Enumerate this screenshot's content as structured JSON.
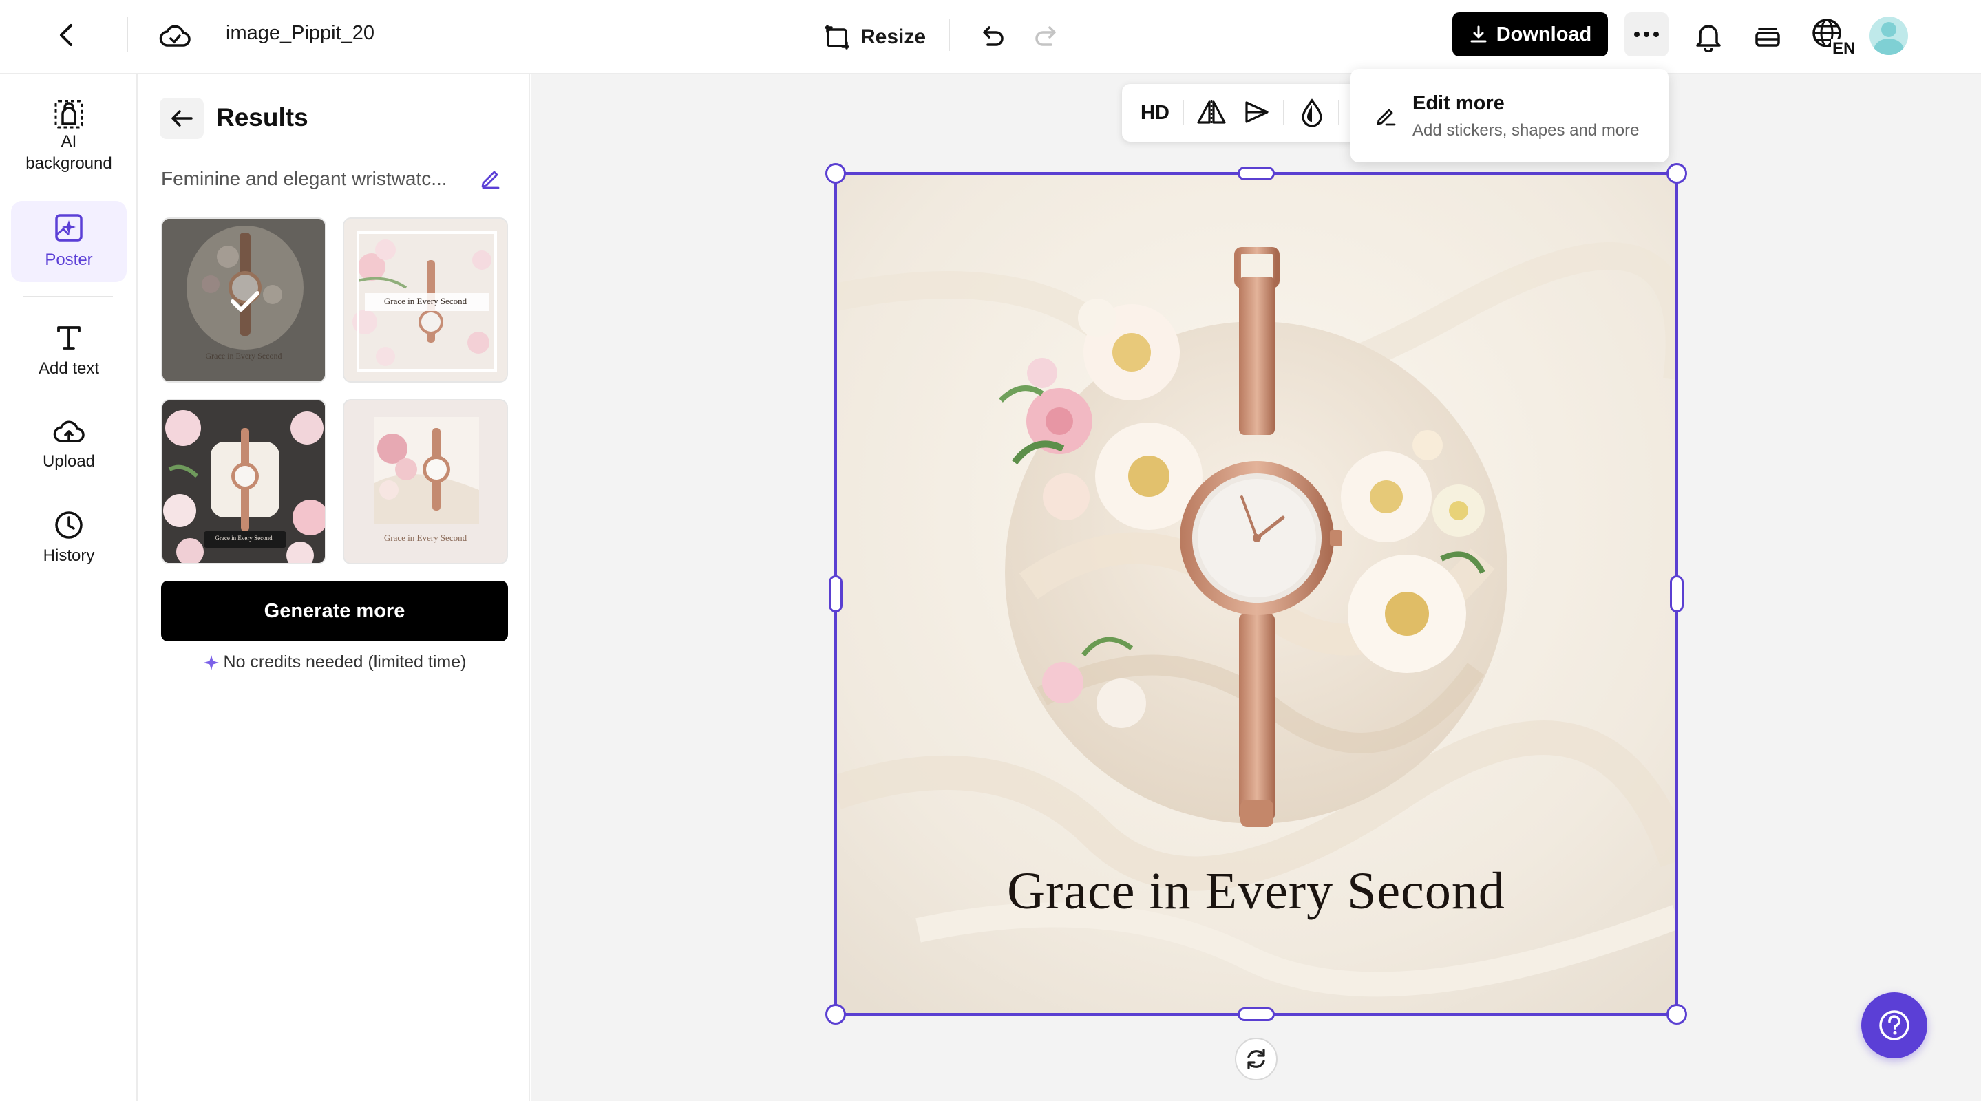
{
  "topbar": {
    "filename": "image_Pippit_20",
    "resize_label": "Resize",
    "download_label": "Download",
    "language_code": "EN"
  },
  "leftnav": {
    "items": [
      {
        "label": "AI background",
        "icon": "ai-background-icon"
      },
      {
        "label": "Poster",
        "icon": "poster-icon",
        "active": true
      },
      {
        "label": "Add text",
        "icon": "text-icon"
      },
      {
        "label": "Upload",
        "icon": "upload-icon"
      },
      {
        "label": "History",
        "icon": "history-icon"
      }
    ]
  },
  "panel": {
    "title": "Results",
    "prompt": "Feminine and elegant wristwatc...",
    "thumb_captions": [
      "Grace in Every Second",
      "Grace in Every Second",
      "Grace in Every Second",
      "Grace in Every Second"
    ],
    "generate_label": "Generate more",
    "credits_note": "No credits needed (limited time)"
  },
  "toolbar": {
    "hd_label": "HD"
  },
  "dropdown": {
    "title": "Edit more",
    "subtitle": "Add stickers, shapes and more"
  },
  "poster": {
    "headline": "Grace in Every Second"
  },
  "colors": {
    "accent": "#5b3fd6",
    "selection": "#5a3fd1",
    "primary_button": "#000000"
  }
}
